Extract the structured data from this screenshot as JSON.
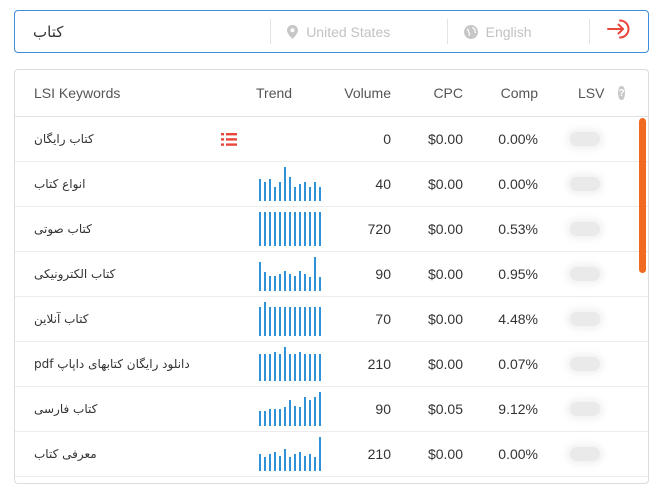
{
  "search": {
    "query": "کتاب",
    "country": "United States",
    "language": "English"
  },
  "table": {
    "headers": {
      "keyword": "LSI Keywords",
      "trend": "Trend",
      "volume": "Volume",
      "cpc": "CPC",
      "comp": "Comp",
      "lsv": "LSV"
    },
    "rows": [
      {
        "keyword": "کتاب رایگان",
        "volume": "0",
        "cpc": "$0.00",
        "comp": "0.00%",
        "trend": [],
        "has_list_icon": true
      },
      {
        "keyword": "انواع کتاب",
        "volume": "40",
        "cpc": "$0.00",
        "comp": "0.00%",
        "trend": [
          0.65,
          0.55,
          0.65,
          0.4,
          0.55,
          1.0,
          0.7,
          0.4,
          0.5,
          0.55,
          0.4,
          0.55,
          0.4
        ]
      },
      {
        "keyword": "کتاب صوتی",
        "volume": "720",
        "cpc": "$0.00",
        "comp": "0.53%",
        "trend": [
          1.0,
          1.0,
          1.0,
          1.0,
          1.0,
          1.0,
          1.0,
          1.0,
          1.0,
          1.0,
          1.0,
          1.0,
          1.0
        ]
      },
      {
        "keyword": "کتاب الکترونیکی",
        "volume": "90",
        "cpc": "$0.00",
        "comp": "0.95%",
        "trend": [
          0.85,
          0.55,
          0.45,
          0.45,
          0.5,
          0.6,
          0.5,
          0.45,
          0.6,
          0.5,
          0.4,
          1.0,
          0.4
        ]
      },
      {
        "keyword": "کتاب آنلاین",
        "volume": "70",
        "cpc": "$0.00",
        "comp": "4.48%",
        "trend": [
          0.85,
          1.0,
          0.85,
          0.85,
          0.85,
          0.85,
          0.85,
          0.85,
          0.85,
          0.85,
          0.85,
          0.85,
          0.85
        ]
      },
      {
        "keyword": "دانلود رایگان کتابهای داپاپ pdf",
        "volume": "210",
        "cpc": "$0.00",
        "comp": "0.07%",
        "trend": [
          0.8,
          0.8,
          0.8,
          0.85,
          0.8,
          1.0,
          0.8,
          0.8,
          0.85,
          0.8,
          0.8,
          0.8,
          0.8
        ]
      },
      {
        "keyword": "کتاب فارسی",
        "volume": "90",
        "cpc": "$0.05",
        "comp": "9.12%",
        "trend": [
          0.45,
          0.45,
          0.5,
          0.5,
          0.5,
          0.55,
          0.75,
          0.6,
          0.55,
          0.85,
          0.75,
          0.85,
          1.0
        ]
      },
      {
        "keyword": "معرفی کتاب",
        "volume": "210",
        "cpc": "$0.00",
        "comp": "0.00%",
        "trend": [
          0.5,
          0.4,
          0.5,
          0.55,
          0.45,
          0.65,
          0.4,
          0.5,
          0.55,
          0.45,
          0.5,
          0.4,
          1.0
        ]
      }
    ]
  },
  "colors": {
    "accent": "#3d8fd9",
    "trend_bar": "#2f91d6",
    "go_icon": "#e9463b",
    "scrollbar": "#f06a22",
    "list_icon": "#e9463b"
  }
}
